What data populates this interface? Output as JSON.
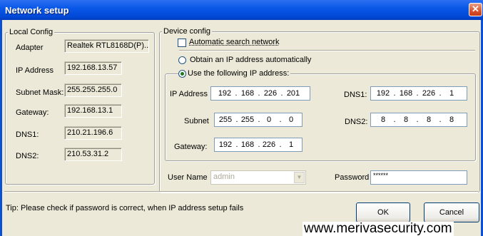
{
  "window": {
    "title": "Network setup",
    "close_glyph": "✕"
  },
  "local_config": {
    "title": "Local Config",
    "rows": [
      {
        "label": "Adapter",
        "value": "Realtek RTL8168D(P)..."
      },
      {
        "label": "IP Address",
        "value": "192.168.13.57"
      },
      {
        "label": "Subnet Mask:",
        "value": "255.255.255.0"
      },
      {
        "label": "Gateway:",
        "value": "192.168.13.1"
      },
      {
        "label": "DNS1:",
        "value": "210.21.196.6"
      },
      {
        "label": "DNS2:",
        "value": "210.53.31.2"
      }
    ]
  },
  "device_config": {
    "title": "Device config",
    "auto_search_label": "Automatic search network",
    "auto_search_checked": false,
    "obtain_auto_label": "Obtain an IP address automatically",
    "use_following_label": "Use the following IP address:",
    "selected_mode": "use_following",
    "ip_label": "IP Address",
    "ip": [
      "192",
      "168",
      "226",
      "201"
    ],
    "subnet_label": "Subnet",
    "subnet": [
      "255",
      "255",
      "0",
      "0"
    ],
    "gateway_label": "Gateway:",
    "gateway": [
      "192",
      "168",
      "226",
      "1"
    ],
    "dns1_label": "DNS1:",
    "dns1": [
      "192",
      "168",
      "226",
      "1"
    ],
    "dns2_label": "DNS2:",
    "dns2": [
      "8",
      "8",
      "8",
      "8"
    ],
    "username_label": "User Name",
    "username_value": "admin",
    "password_label": "Password",
    "password_value": "******"
  },
  "tip": "Tip:  Please check if password is correct, when IP address setup fails",
  "buttons": {
    "ok": "OK",
    "cancel": "Cancel"
  },
  "watermark": "www.merivasecurity.com",
  "colors": {
    "title_bar": "#0a58e8",
    "dialog_bg": "#ece9d8",
    "close_button": "#d9532e"
  }
}
